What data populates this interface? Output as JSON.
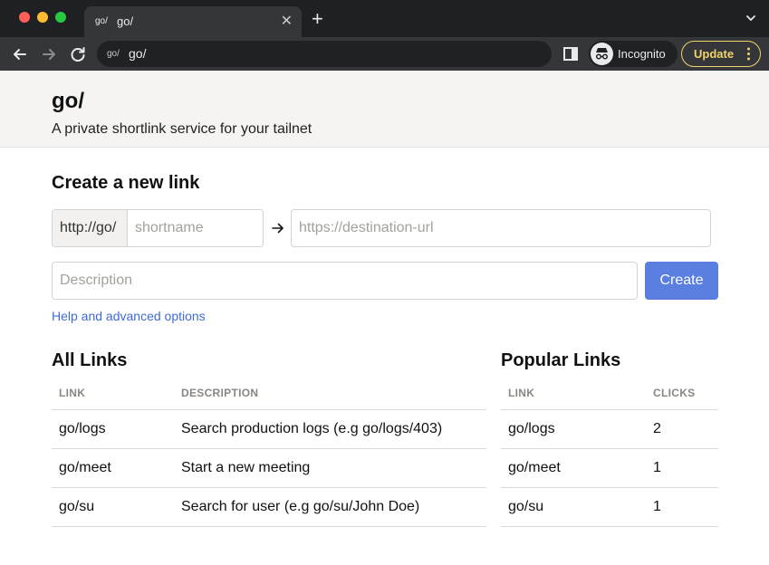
{
  "browser": {
    "tab": {
      "favicon_text": "go/",
      "title": "go/"
    },
    "address": {
      "favicon_text": "go/",
      "url": "go/"
    },
    "incognito_label": "Incognito",
    "update_label": "Update"
  },
  "header": {
    "title": "go/",
    "tagline": "A private shortlink service for your tailnet"
  },
  "create": {
    "heading": "Create a new link",
    "prefix": "http://go/",
    "shortname_placeholder": "shortname",
    "destination_placeholder": "https://destination-url",
    "description_placeholder": "Description",
    "button_label": "Create",
    "help_link": "Help and advanced options"
  },
  "all_links": {
    "heading": "All Links",
    "columns": [
      "LINK",
      "DESCRIPTION"
    ],
    "rows": [
      {
        "link": "go/logs",
        "description": "Search production logs (e.g go/logs/403)"
      },
      {
        "link": "go/meet",
        "description": "Start a new meeting"
      },
      {
        "link": "go/su",
        "description": "Search for user (e.g go/su/John Doe)"
      }
    ]
  },
  "popular_links": {
    "heading": "Popular Links",
    "columns": [
      "LINK",
      "CLICKS"
    ],
    "rows": [
      {
        "link": "go/logs",
        "clicks": "2"
      },
      {
        "link": "go/meet",
        "clicks": "1"
      },
      {
        "link": "go/su",
        "clicks": "1"
      }
    ]
  },
  "colors": {
    "accent": "#5a7fe0",
    "link": "#3f6ad8",
    "header_bg": "#f5f4f2",
    "update_accent": "#f1d36b"
  },
  "icons": [
    "close-icon",
    "plus-icon",
    "chevron-down-icon",
    "back-icon",
    "forward-icon",
    "reload-icon",
    "side-panel-icon",
    "incognito-icon",
    "more-vert-icon",
    "arrow-right-icon"
  ]
}
